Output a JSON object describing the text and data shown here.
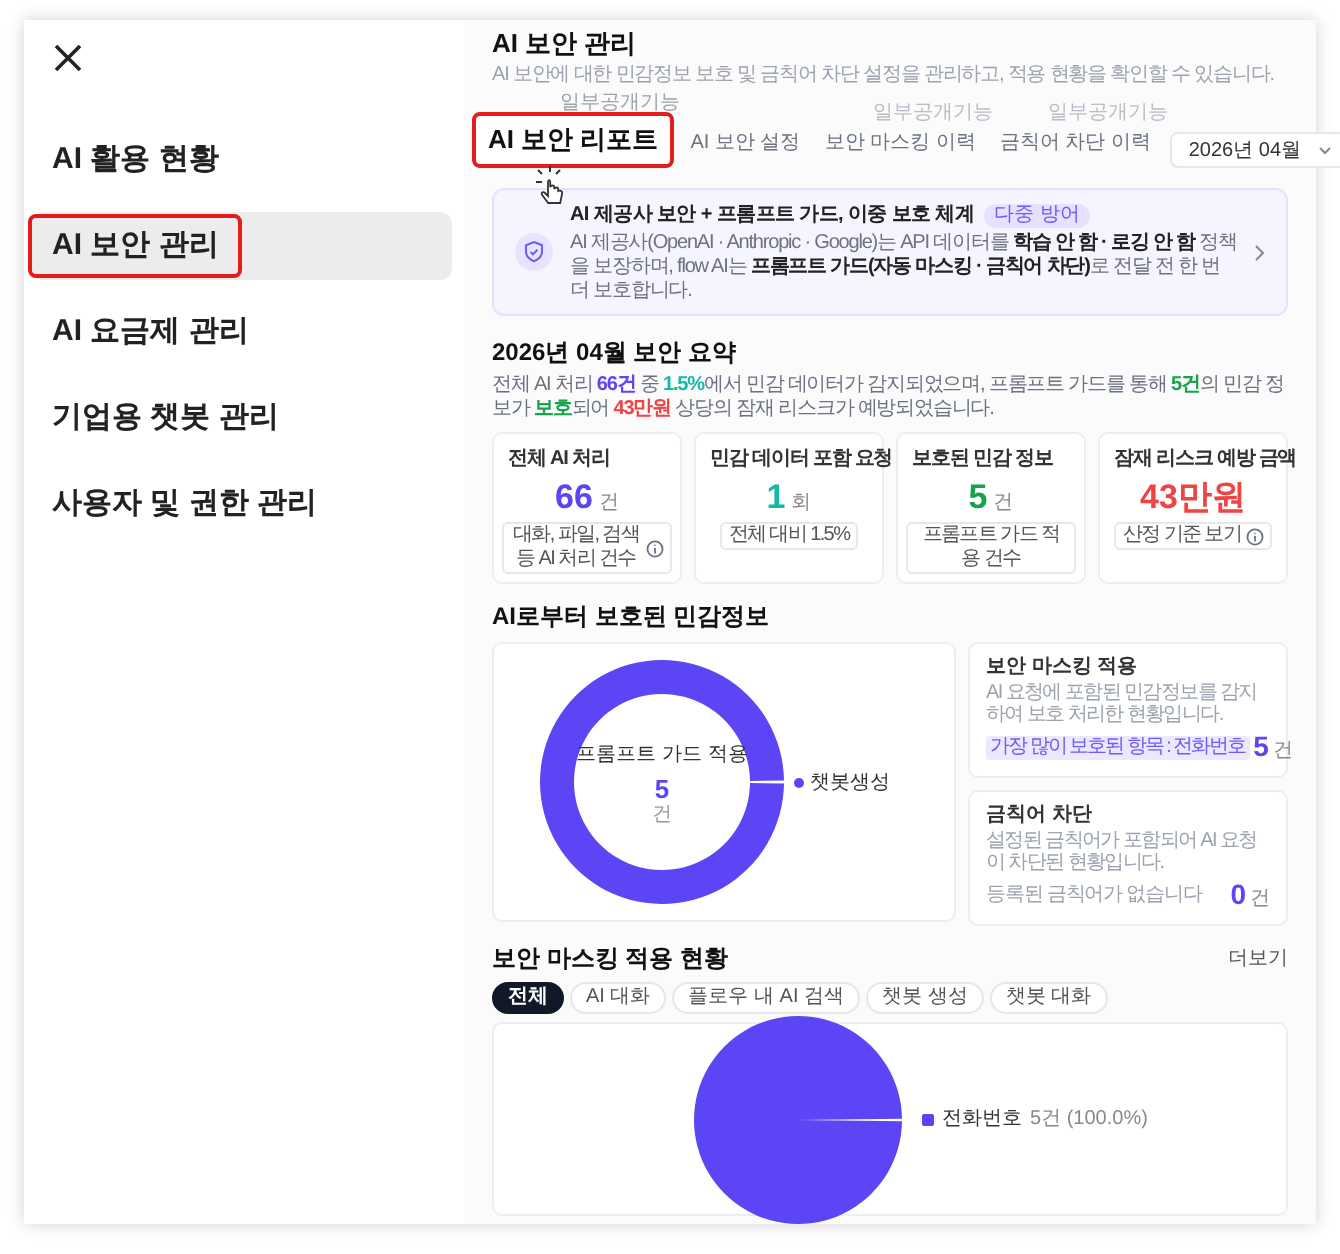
{
  "sidebar": {
    "items": [
      {
        "label": "AI 활용 현황",
        "selected": false,
        "annotated": false
      },
      {
        "label": "AI 보안 관리",
        "selected": true,
        "annotated": true
      },
      {
        "label": "AI 요금제 관리",
        "selected": false,
        "annotated": false
      },
      {
        "label": "기업용 챗봇 관리",
        "selected": false,
        "annotated": false
      },
      {
        "label": "사용자 및 권한 관리",
        "selected": false,
        "annotated": false
      }
    ]
  },
  "page": {
    "title": "AI 보안 관리",
    "subtitle": "AI 보안에 대한 민감정보 보호 및 금칙어 차단 설정을 관리하고, 적용 현황을 확인할 수 있습니다."
  },
  "tabs": [
    {
      "label": "AI 보안 리포트",
      "selected": true,
      "annotated": true,
      "badge": "일부공개기능"
    },
    {
      "label": "AI 보안 설정",
      "selected": false,
      "annotated": false
    },
    {
      "label": "보안 마스킹 이력",
      "selected": false,
      "annotated": false,
      "badge": "일부공개기능"
    },
    {
      "label": "금칙어 차단 이력",
      "selected": false,
      "annotated": false,
      "badge": "일부공개기능"
    }
  ],
  "month_select": {
    "value": "2026년 04월"
  },
  "banner": {
    "title": "AI 제공사 보안 + 프롬프트 가드, 이중 보호 체계",
    "tag": "다중 방어",
    "body": "AI 제공사(OpenAI · Anthropic · Google)는 API 데이터를 **학습 안 함 · 로깅 안 함** 정책을 보장하며, flow AI는 **프롬프트 가드(자동 마스킹 · 금칙어 차단)**로 전달 전 한 번 더 보호합니다."
  },
  "summary": {
    "heading": "2026년 04월 보안 요약",
    "segments": [
      {
        "text": "전체 AI 처리 "
      },
      {
        "text": "66건",
        "color": "#5b45f5"
      },
      {
        "text": " 중 "
      },
      {
        "text": "1.5%",
        "color": "#14b8a6"
      },
      {
        "text": "에서 민감 데이터가 감지되었으며, 프롬프트 가드를 통해 "
      },
      {
        "text": "5건",
        "color": "#16a34a"
      },
      {
        "text": "의 민감 정보가 "
      },
      {
        "text": "보호",
        "color": "#16a34a"
      },
      {
        "text": "되어 "
      },
      {
        "text": "43만원",
        "color": "#ef4444"
      },
      {
        "text": " 상당의 잠재 리스크가 예방되었습니다."
      }
    ]
  },
  "stat_cards": [
    {
      "title": "전체 AI 처리",
      "value": "66",
      "unit": "건",
      "color": "#5b45f5",
      "caption": "대화, 파일, 검색 등 AI 처리 건수",
      "info": true
    },
    {
      "title": "민감 데이터 포함 요청",
      "value": "1",
      "unit": "회",
      "color": "#14b8a6",
      "caption": "전체 대비 1.5%",
      "info": false
    },
    {
      "title": "보호된 민감 정보",
      "value": "5",
      "unit": "건",
      "color": "#16a34a",
      "caption": "프롬프트 가드 적용 건수",
      "info": false
    },
    {
      "title": "잠재 리스크 예방 금액",
      "value": "43만원",
      "color": "#ef4444",
      "caption": "산정 기준 보기",
      "info": true
    }
  ],
  "protected": {
    "heading": "AI로부터 보호된 민감정보",
    "donut": {
      "center_label": "프롬프트 가드 적용",
      "center_value": "5",
      "center_unit": "건",
      "legend": [
        "챗봇생성"
      ]
    },
    "masking_card": {
      "title": "보안 마스킹 적용",
      "desc": "AI 요청에 포함된 민감정보를 감지하여 보호 처리한 현황입니다.",
      "tag": "가장 많이 보호된 항목 : 전화번호",
      "value": "5",
      "unit": "건"
    },
    "blocked_card": {
      "title": "금칙어 차단",
      "desc": "설정된 금칙어가 포함되어 AI 요청이 차단된 현황입니다.",
      "note": "등록된 금칙어가 없습니다",
      "value": "0",
      "unit": "건"
    }
  },
  "masking_status": {
    "heading": "보안 마스킹 적용 현황",
    "more": "더보기",
    "filters": [
      {
        "label": "전체",
        "selected": true
      },
      {
        "label": "AI 대화",
        "selected": false
      },
      {
        "label": "플로우 내 AI 검색",
        "selected": false
      },
      {
        "label": "챗봇 생성",
        "selected": false
      },
      {
        "label": "챗봇 대화",
        "selected": false
      }
    ],
    "legend": [
      {
        "label": "전화번호",
        "value": "5건 (100.0%)"
      }
    ]
  }
}
